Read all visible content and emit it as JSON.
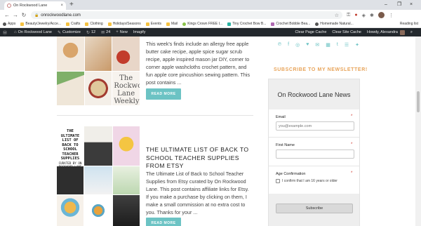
{
  "browser": {
    "tab_title": "On Rockwood Lane",
    "tab_close": "×",
    "new_tab": "+",
    "url": "onrockwoodlane.com",
    "window_min": "–",
    "window_max": "❐",
    "window_close": "×"
  },
  "bookmarks": {
    "apps": "Apps",
    "items": [
      "Beauty/Jewelry/Acce...",
      "Crafts",
      "Clothing",
      "Holidays/Seasons",
      "Events",
      "Mail",
      "Kings Crown FREE I...",
      "Tiny Crochet Bow B...",
      "Crochet Bobble Bea...",
      "Homemade Natural..."
    ],
    "reading_list": "Reading list"
  },
  "adminbar": {
    "site": "On Rockwood Lane",
    "customize": "Customize",
    "updates": "12",
    "comments": "24",
    "new": "New",
    "imagify": "Imagify",
    "clear_page_cache": "Clear Page Cache",
    "clear_site_cache": "Clear Site Cache",
    "howdy": "Howdy, Alexandra"
  },
  "post1": {
    "thumb_text": "The Rockwood Lane Weekly 8",
    "excerpt": "This week's finds include an allergy free apple butter cake recipe, apple spice sugar scrub recipe, apple inspired mason jar DIY, corner to corner apple washcloths crochet pattern, and fun apple core pincushion sewing pattern. This post contains ...",
    "read_more": "READ MORE"
  },
  "post2": {
    "thumb_head": "THE ULTIMATE LIST OF BACK TO SCHOOL TEACHER SUPPLIES",
    "thumb_sub": "CURATED BY ON ROCKWOOD LANE",
    "title": "THE ULTIMATE LIST OF BACK TO SCHOOL TEACHER SUPPLIES FROM ETSY",
    "excerpt": "The Ultimate List of Back to School Teacher Supplies from Etsy curated by On Rockwood Lane. This post contains affiliate links for Etsy. If you make a purchase by clicking on them, I make a small commission at no extra cost to you. Thanks for your ...",
    "read_more": "READ MORE"
  },
  "sidebar": {
    "newsletter_heading": "SUBSCRIBE TO MY NEWSLETTER!",
    "form_title": "On Rockwood Lane News",
    "email_label": "Email",
    "email_placeholder": "you@example.com",
    "first_name_label": "First Name",
    "age_label": "Age Confirmation",
    "age_checkbox_label": "I confirm that I am 16 years or older",
    "required_mark": "*",
    "subscribe_button": "Subscribe"
  },
  "colors": {
    "accent_teal": "#6cc3c4",
    "heading_orange": "#e8a45a",
    "admin_bar": "#23282d",
    "required_red": "#d0342c"
  }
}
